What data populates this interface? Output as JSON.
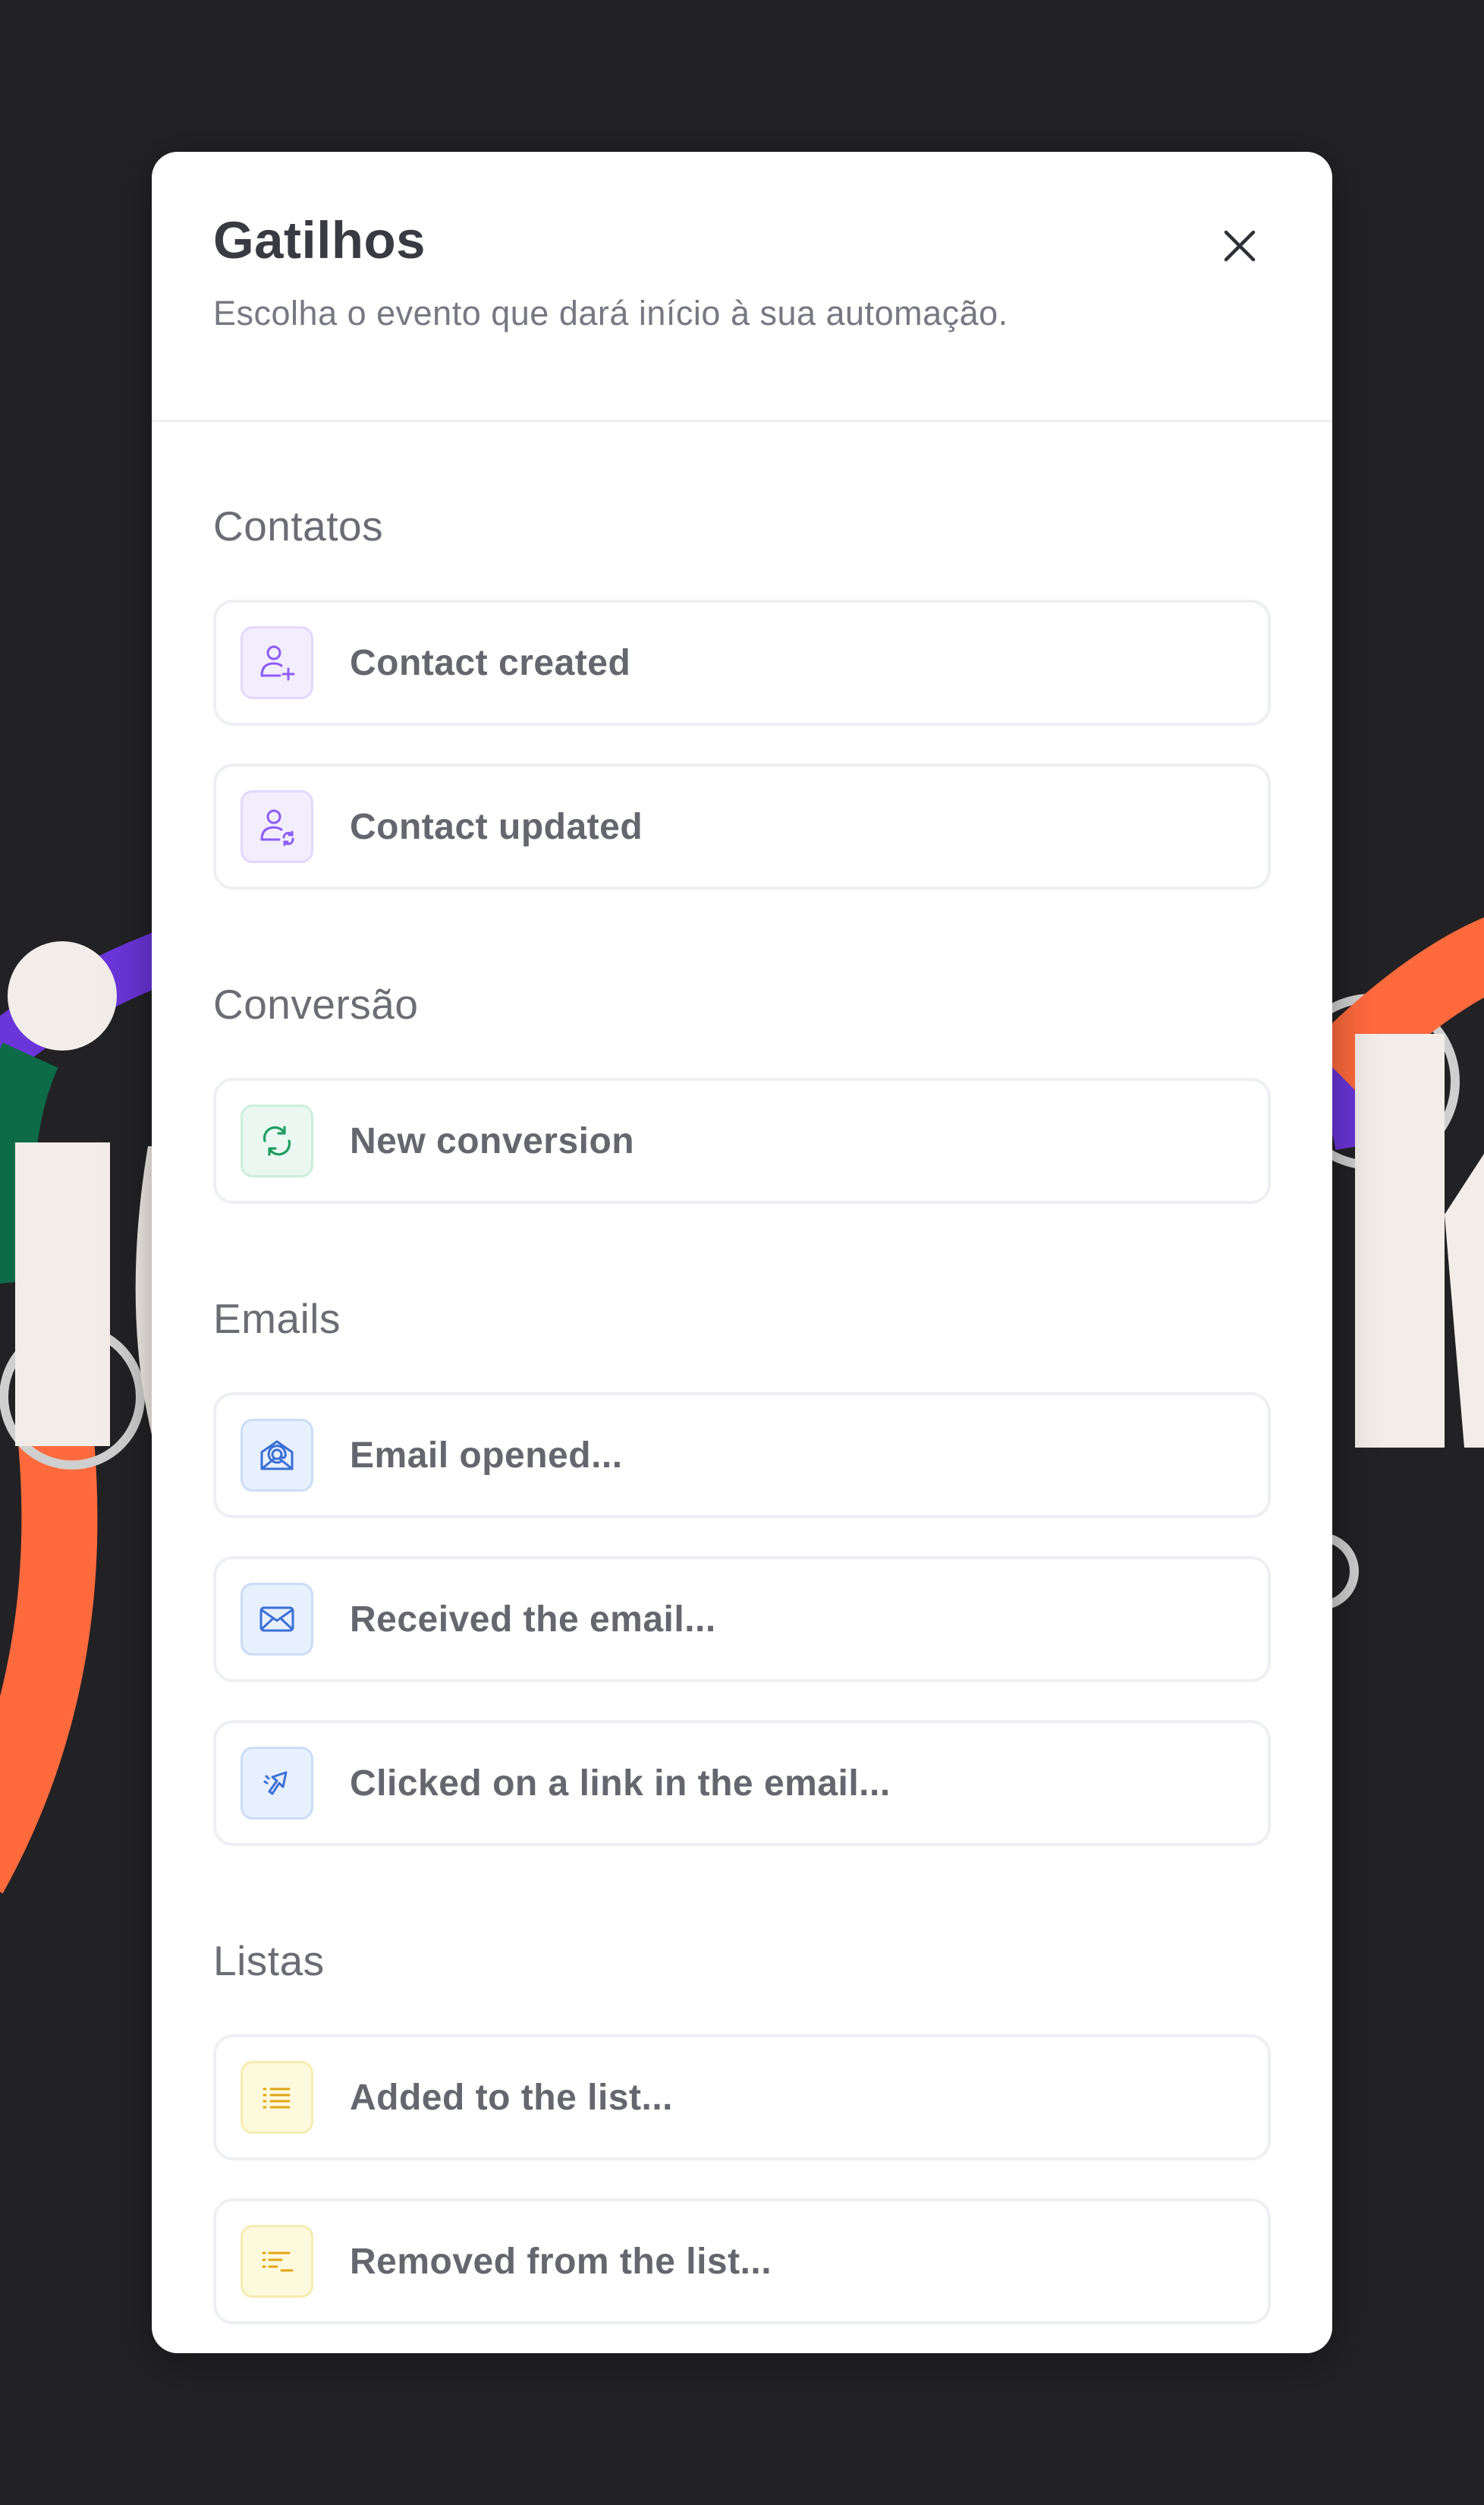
{
  "modal": {
    "title": "Gatilhos",
    "subtitle": "Escolha o evento que dará início à sua automação.",
    "close_icon": "close-icon"
  },
  "sections": [
    {
      "title": "Contatos",
      "items": [
        {
          "label": "Contact created",
          "icon": "user-plus-icon",
          "color": "#8b5cf6"
        },
        {
          "label": "Contact updated",
          "icon": "user-refresh-icon",
          "color": "#8b5cf6"
        }
      ]
    },
    {
      "title": "Conversão",
      "items": [
        {
          "label": "New conversion",
          "icon": "conversion-arrows-icon",
          "color": "#1f9d63"
        }
      ]
    },
    {
      "title": "Emails",
      "items": [
        {
          "label": "Email opened...",
          "icon": "email-open-icon",
          "color": "#3b6fd6"
        },
        {
          "label": "Received the email...",
          "icon": "envelope-icon",
          "color": "#3b6fd6"
        },
        {
          "label": "Clicked on a link in the email...",
          "icon": "cursor-click-icon",
          "color": "#3b6fd6"
        }
      ]
    },
    {
      "title": "Listas",
      "items": [
        {
          "label": "Added to the list...",
          "icon": "list-icon",
          "color": "#e0a515"
        },
        {
          "label": "Removed from the list...",
          "icon": "list-remove-icon",
          "color": "#e0a515"
        }
      ]
    }
  ],
  "colors": {
    "background": "#222224",
    "modal": "#ffffff",
    "title": "#3a3b42",
    "subtitle": "#777881",
    "section_title": "#6b6c74",
    "item_label": "#65666e",
    "item_border": "#eeeff2",
    "accent_purple": "#8b5cf6",
    "accent_green": "#1f9d63",
    "accent_blue": "#3b6fd6",
    "accent_yellow": "#e0a515",
    "deco_orange": "#ff6a3d",
    "deco_purple": "#6a35d9",
    "deco_green": "#0e6b47",
    "deco_cream": "#f2ede8"
  }
}
